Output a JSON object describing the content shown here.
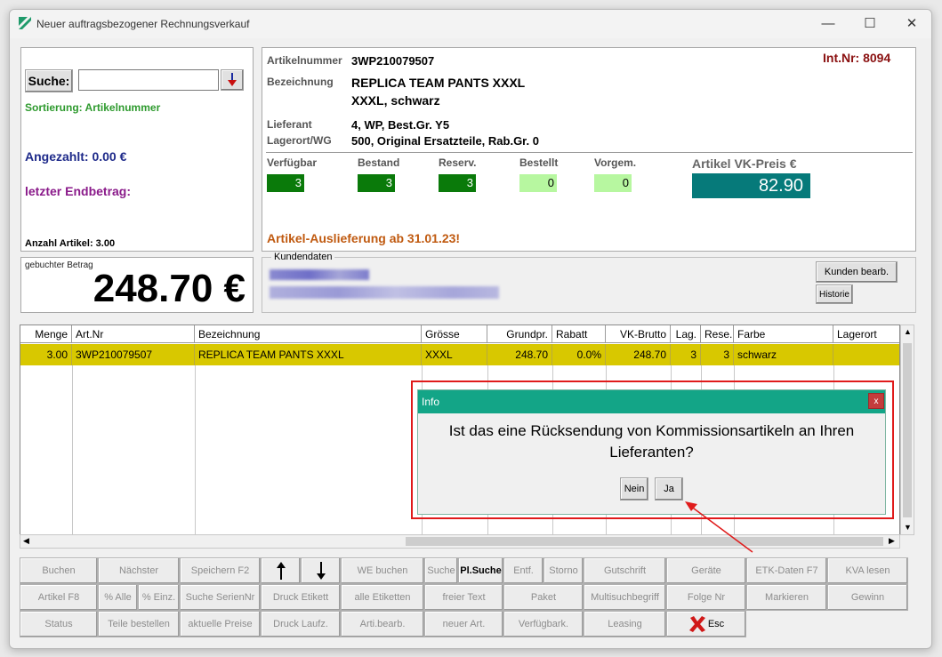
{
  "window": {
    "title": "Neuer auftragsbezogener Rechnungsverkauf"
  },
  "search": {
    "label": "Suche:",
    "value": "",
    "sort_label": "Sortierung: Artikelnummer"
  },
  "left": {
    "angezahlt": "Angezahlt: 0.00 €",
    "letzter": "letzter Endbetrag:",
    "anzahl": "Anzahl Artikel: 3.00",
    "gebucht_label": "gebuchter Betrag",
    "gebucht_value": "248.70 €"
  },
  "article": {
    "artnr_label": "Artikelnummer",
    "artnr": "3WP210079507",
    "bez_label": "Bezeichnung",
    "bez1": "REPLICA TEAM PANTS XXXL",
    "bez2": "XXXL, schwarz",
    "lief_label": "Lieferant",
    "lief": "4, WP, Best.Gr. Y5",
    "lager_label": "Lagerort/WG",
    "lager": "500, Original Ersatzteile, Rab.Gr. 0",
    "intnr": "Int.Nr: 8094",
    "verf_label": "Verfügbar",
    "verf": "3",
    "bestand_label": "Bestand",
    "bestand": "3",
    "reserv_label": "Reserv.",
    "reserv": "3",
    "bestellt_label": "Bestellt",
    "bestellt": "0",
    "vorgem_label": "Vorgem.",
    "vorgem": "0",
    "vkpreis_label": "Artikel VK-Preis €",
    "vkpreis": "82.90",
    "auslieferung": "Artikel-Auslieferung ab 31.01.23!"
  },
  "kunden": {
    "legend": "Kundendaten",
    "edit_btn": "Kunden bearb.",
    "hist_btn": "Historie"
  },
  "table": {
    "headers": [
      "Menge",
      "Art.Nr",
      "Bezeichnung",
      "Grösse",
      "Grundpr.",
      "Rabatt",
      "VK-Brutto",
      "Lag.",
      "Rese.",
      "Farbe",
      "Lagerort"
    ],
    "row": [
      "3.00",
      "3WP210079507",
      "REPLICA TEAM PANTS XXXL",
      "XXXL",
      "248.70",
      "0.0%",
      "248.70",
      "3",
      "3",
      "schwarz",
      ""
    ]
  },
  "dialog": {
    "title": "Info",
    "question_line1": "Ist das eine Rücksendung von Kommissionsartikeln an Ihren",
    "question_line2": "Lieferanten?",
    "nein": "Nein",
    "ja": "Ja",
    "close": "x"
  },
  "buttons": {
    "row1": [
      "Buchen",
      "Nächster",
      "Speichern F2",
      "",
      "",
      "WE buchen",
      "Suche",
      "Pl.Suche",
      "Entf.",
      "Storno",
      "Gutschrift",
      "Geräte",
      "ETK-Daten F7",
      "KVA lesen"
    ],
    "row2": [
      "Artikel F8",
      "% Alle",
      "% Einz.",
      "Suche SerienNr",
      "Druck Etikett",
      "alle Etiketten",
      "freier Text",
      "Paket",
      "Multisuchbegriff",
      "Folge Nr",
      "Markieren",
      "Gewinn"
    ],
    "row3": [
      "Status",
      "Teile bestellen",
      "aktuelle Preise",
      "Druck Laufz.",
      "Arti.bearb.",
      "neuer Art.",
      "Verfügbark.",
      "Leasing",
      "Esc"
    ]
  },
  "colors": {
    "accent": "#13a587",
    "stock_dark": "#0a7a0a",
    "stock_light": "#b7f7a0",
    "price": "#067a7a",
    "highlight": "#d8c800"
  }
}
